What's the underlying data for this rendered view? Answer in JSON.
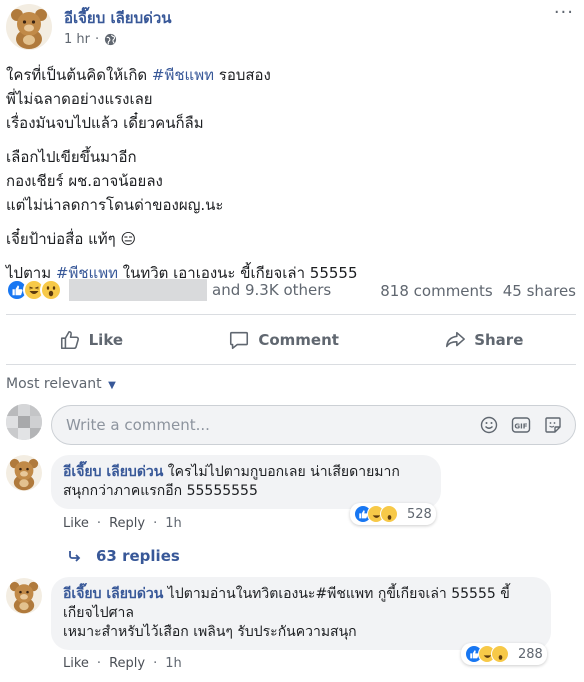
{
  "post": {
    "page_name": "อีเจี๊ยบ เลียบด่วน",
    "time": "1 hr",
    "more_label": "···",
    "lines": [
      [
        "ใครที่เป็นต้นคิดให้เกิด ",
        "#พีชแพท",
        " รอบสอง"
      ],
      [
        "พี่ไม่ฉลาดอย่างแรงเลย"
      ],
      [
        "เรื่องมันจบไปแล้ว เดี๋ยวคนก็ลืม"
      ],
      [
        "เลือกไปเขียขึ้นมาอีก"
      ],
      [
        "กองเชียร์ ผช.อาจน้อยลง"
      ],
      [
        "แต่ไม่น่าลดการโดนด่าของผญ.นะ"
      ],
      [
        "เจี๋ยป้าบ่อสื่อ แท้ๆ 😑"
      ],
      [
        "ไปตาม ",
        "#พีชแพท",
        " ในทวิต เอาเองนะ ขี้เกียจเล่า 55555"
      ]
    ],
    "reactions_others": "and 9.3K others",
    "comments_count": "818 comments",
    "shares_count": "45 shares"
  },
  "actions": {
    "like": "Like",
    "comment": "Comment",
    "share": "Share"
  },
  "filter": {
    "most_relevant": "Most relevant"
  },
  "composer": {
    "placeholder": "Write a comment..."
  },
  "comments": [
    {
      "author": "อีเจี๊ยบ เลียบด่วน",
      "text_line1": " ใครไม่ไปตามกูบอกเลย น่าเสียดายมาก",
      "text_line2": "สนุกกว่าภาคแรกอีก 55555555",
      "like": "Like",
      "reply": "Reply",
      "time": "1h",
      "reaction_count": "528",
      "replies": "63 replies"
    },
    {
      "author": "อีเจี๊ยบ เลียบด่วน",
      "text_line1": " ไปตามอ่านในทวิตเองนะ#พีชแพท กูขี้เกียจเล่า 55555 ขี้",
      "text_line2": "เกียจไปศาล",
      "text_line3": "เหมาะสำหรับไว้เสือก เพลินๆ รับประกันความสนุก",
      "like": "Like",
      "reply": "Reply",
      "time": "1h",
      "reaction_count": "288"
    }
  ],
  "colors": {
    "link": "#385898",
    "secondary_text": "#606770",
    "like_blue": "#1877f2"
  }
}
